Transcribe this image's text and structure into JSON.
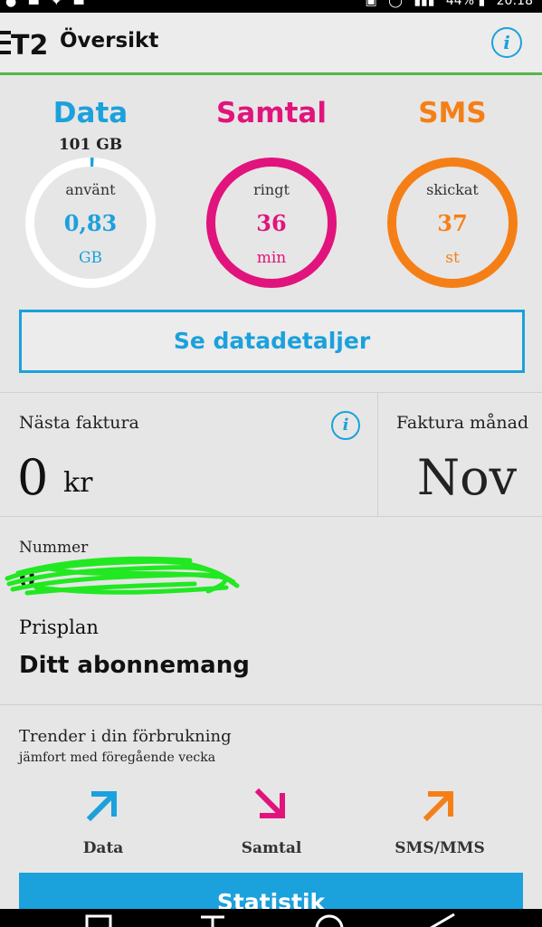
{
  "status_bar": {
    "battery": "44%",
    "time": "20:18"
  },
  "app_bar": {
    "logo_text": "T2",
    "title": "Översikt",
    "info_label": "i"
  },
  "usage": {
    "data": {
      "title": "Data",
      "limit": "101 GB",
      "label": "använt",
      "value": "0,83",
      "unit": "GB",
      "color": "#1ba1dc",
      "fill_fraction": 0.008
    },
    "calls": {
      "title": "Samtal",
      "label": "ringt",
      "value": "36",
      "unit": "min",
      "color": "#e0147c",
      "fill_fraction": 1.0
    },
    "sms": {
      "title": "SMS",
      "label": "skickat",
      "value": "37",
      "unit": "st",
      "color": "#f57f17",
      "fill_fraction": 1.0
    },
    "details_button": "Se datadetaljer"
  },
  "invoice": {
    "next_label": "Nästa faktura",
    "info_label": "i",
    "amount": "0",
    "currency": "kr",
    "month_label": "Faktura månad",
    "month_value": "Nov"
  },
  "account": {
    "number_label": "Nummer",
    "number_value": "0",
    "plan_label": "Prisplan",
    "plan_value": "Ditt abonnemang"
  },
  "trends": {
    "title": "Trender i din förbrukning",
    "subtitle": "jämfort med föregående vecka",
    "items": [
      {
        "label": "Data",
        "direction": "up",
        "color": "#1ba1dc"
      },
      {
        "label": "Samtal",
        "direction": "down",
        "color": "#e0147c"
      },
      {
        "label": "SMS/MMS",
        "direction": "up",
        "color": "#f57f17"
      }
    ],
    "stats_button": "Statistik"
  }
}
